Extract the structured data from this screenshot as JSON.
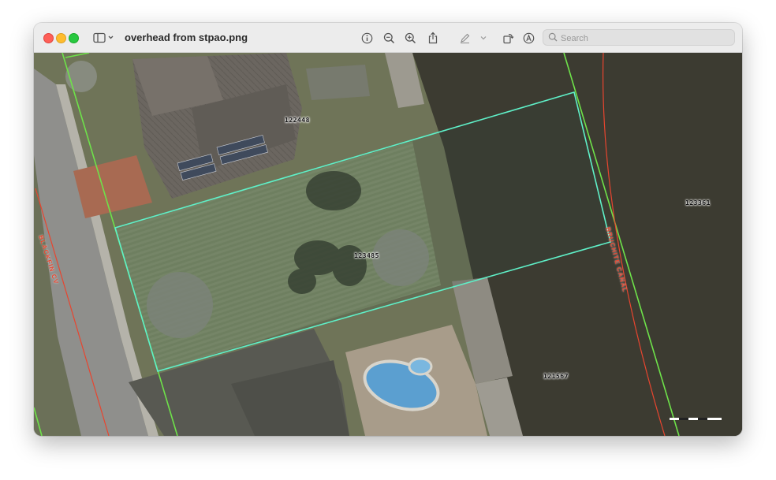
{
  "window": {
    "title": "overhead from stpao.png"
  },
  "toolbar": {
    "search_placeholder": "Search"
  },
  "map": {
    "parcels": [
      {
        "id": "parcel-label-122448",
        "label": "122448"
      },
      {
        "id": "parcel-label-123485",
        "label": "123485"
      },
      {
        "id": "parcel-label-123361",
        "label": "123361"
      },
      {
        "id": "parcel-label-121567",
        "label": "121567"
      }
    ],
    "streets": [
      {
        "id": "street-label-blackfin",
        "label": "BLACKFIN CV"
      },
      {
        "id": "street-label-canal",
        "label": "BRUCHITE CANAL"
      }
    ],
    "colors": {
      "parcel_outline": "#5ff0c8",
      "lot_line": "#6ee24a",
      "street_centerline": "#e8452f",
      "water": "#3b3a2f"
    }
  }
}
